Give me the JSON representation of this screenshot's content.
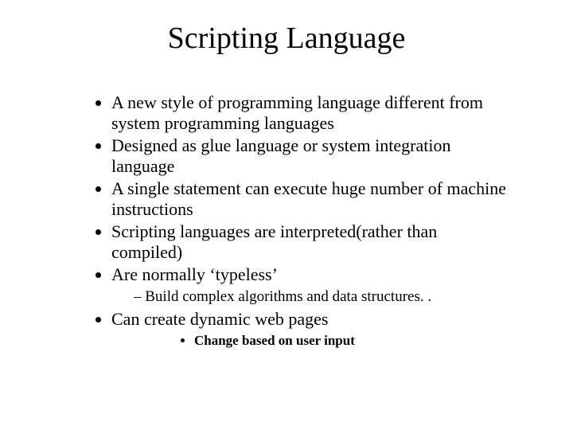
{
  "title": "Scripting Language",
  "bullets": {
    "b1": "A new style of programming language different from system programming languages",
    "b2": "Designed as glue language or system integration language",
    "b3": "A single statement can execute huge number of machine instructions",
    "b4": "Scripting languages are interpreted(rather than compiled)",
    "b5": "Are normally ‘typeless’",
    "b5_sub1": "Build complex algorithms and data structures. .",
    "b6": "Can create dynamic web pages",
    "b6_sub1": "Change based on user input"
  }
}
